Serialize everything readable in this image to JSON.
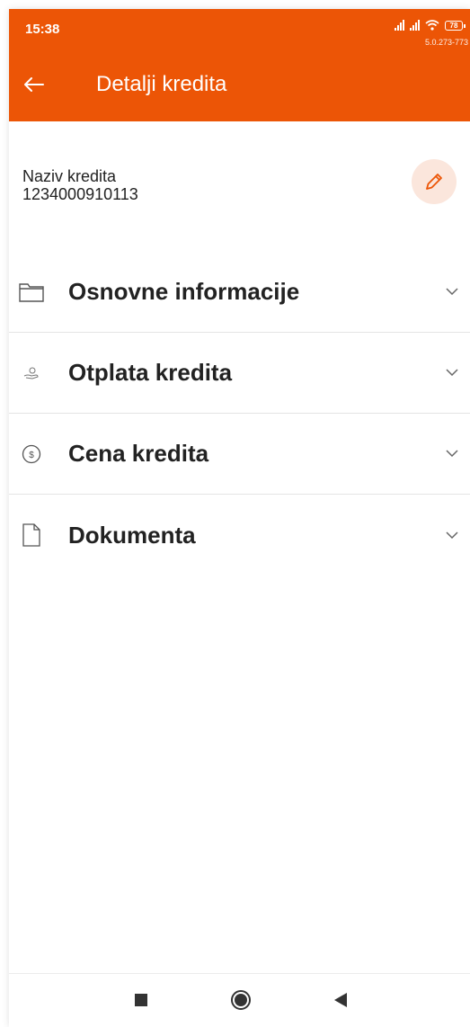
{
  "status_bar": {
    "time": "15:38",
    "battery": "78",
    "version": "5.0.273-773"
  },
  "header": {
    "title": "Detalji kredita",
    "background": "#ec5506"
  },
  "loan": {
    "name_label": "Naziv kredita",
    "number": "1234000910113"
  },
  "sections": [
    {
      "label": "Osnovne informacije",
      "icon": "folder-icon"
    },
    {
      "label": "Otplata kredita",
      "icon": "hand-coin-icon"
    },
    {
      "label": "Cena kredita",
      "icon": "dollar-circle-icon"
    },
    {
      "label": "Dokumenta",
      "icon": "document-icon"
    }
  ],
  "nav": {
    "icons": [
      "recents-square-icon",
      "home-circle-icon",
      "back-triangle-icon"
    ]
  }
}
